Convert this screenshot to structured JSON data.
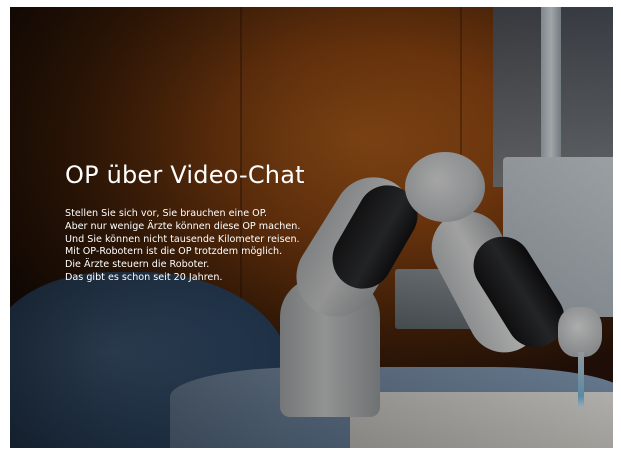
{
  "slide": {
    "title": "OP über Video-Chat",
    "lines": [
      "Stellen Sie sich vor, Sie brauchen eine OP.",
      "Aber nur wenige Ärzte können diese OP machen.",
      "Und Sie können nicht tausende Kilometer reisen.",
      "Mit OP-Robotern ist die OP trotzdem möglich.",
      "Die Ärzte steuern die Roboter.",
      "Das gibt es schon seit 20 Jahren."
    ]
  },
  "image": {
    "subject": "surgical-robot-arm",
    "colors": {
      "wall": "#c46a1e",
      "drape": "#3f6188",
      "robot": "#f3f4f4",
      "text": "#ffffff"
    }
  }
}
